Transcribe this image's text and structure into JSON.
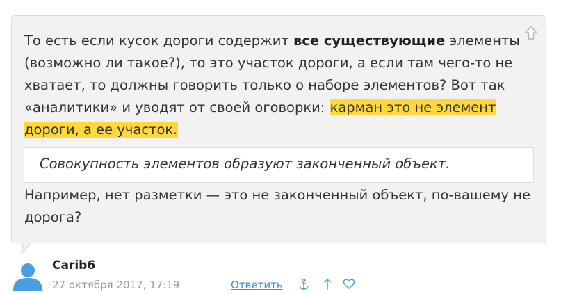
{
  "comment": {
    "para1": {
      "t1": "То есть если кусок дороги содержит ",
      "bold": "все существующие",
      "t2": " элементы (возможно ли такое?), то это участок дороги, а если там чего-то не хватает, то должны говорить только о наборе элементов? Вот так «аналитики» и уводят от своей оговорки: ",
      "highlight": "карман это не элемент дороги, а ее участок."
    },
    "quote": "Совокупность элементов образуют законченный объект.",
    "para2": "Например, нет разметки — это не законченный объект, по-вашему не дорога?"
  },
  "meta": {
    "author": "Carib6",
    "date": "27 октября 2017, 17:19",
    "reply_label": "Ответить"
  },
  "icons": [
    "arrow-up-corner-icon",
    "anchor-icon",
    "arrow-up-icon",
    "heart-icon",
    "user-avatar-icon"
  ],
  "colors": {
    "bubble_bg": "#f2f2f2",
    "highlight": "#ffd83d",
    "link": "#3a8fd6",
    "icon_blue": "#4a9ee0"
  }
}
